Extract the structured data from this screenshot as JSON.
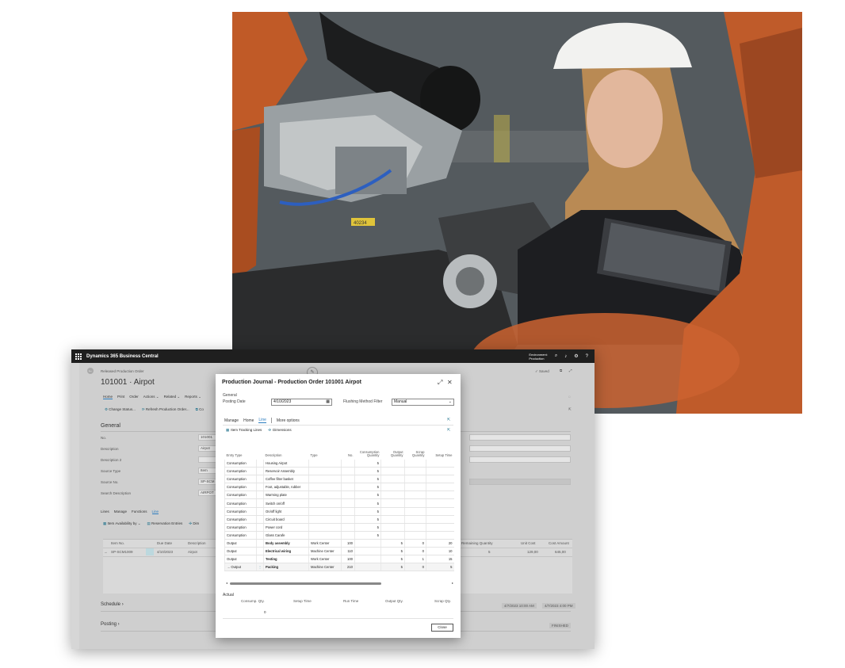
{
  "photo": {
    "tag_label": "40234"
  },
  "app": {
    "name": "Dynamics 365 Business Central",
    "environment": [
      "Environment:",
      "Production"
    ],
    "icons": [
      "waffle-icon",
      "search-icon",
      "bell-icon",
      "gear-icon",
      "help-icon"
    ]
  },
  "page": {
    "breadcrumb": "Released Production Order",
    "title": "101001 · Airpot",
    "status": "✓ Saved",
    "menu": [
      "Home",
      "Print",
      "Order",
      "Actions ⌄",
      "Related ⌄",
      "Reports ⌄"
    ],
    "actions": [
      "Change Status...",
      "Refresh Production Order...",
      "Co"
    ],
    "general_header": "General",
    "fields": [
      {
        "label": "No.",
        "value": "101001"
      },
      {
        "label": "Description",
        "value": "Airpot"
      },
      {
        "label": "Description 2",
        "value": ""
      },
      {
        "label": "Source Type",
        "value": "Item"
      },
      {
        "label": "Source No.",
        "value": "SP-SCM"
      },
      {
        "label": "Search Description",
        "value": "AIRPOT"
      }
    ],
    "lines": {
      "tabs": [
        "Lines",
        "Manage",
        "Functions",
        "Line"
      ],
      "actions": [
        "Item Availability by ⌄",
        "Reservation Entries",
        "Dim"
      ],
      "columns": [
        "Item No.",
        "Due Date",
        "Description",
        "Remaining Quantity",
        "Unit Cost",
        "Cost Amount"
      ],
      "row": {
        "item": "SP-SCM1009",
        "due": "4/10/2023",
        "desc": "Airpot",
        "remaining": "5",
        "unit_cost": "129,00",
        "cost_amount": "645,00"
      }
    },
    "schedule": {
      "label": "Schedule",
      "values": [
        "4/7/2023 10:00 AM",
        "4/7/2023 4:00 PM"
      ]
    },
    "posting": {
      "label": "Posting",
      "value": "FINISHED"
    }
  },
  "dialog": {
    "title": "Production Journal - Production Order 101001 Airpot",
    "general_label": "General",
    "posting_date_label": "Posting Date",
    "posting_date": "4/10/2023",
    "flushing_label": "Flushing Method Filter",
    "flushing_value": "Manual",
    "tabs": [
      "Manage",
      "Home",
      "Line",
      "More options"
    ],
    "actions": [
      "Item Tracking Lines",
      "Dimensions"
    ],
    "columns": [
      "Entry Type",
      "Description",
      "Type",
      "No.",
      "Consumption Quantity",
      "Output Quantity",
      "Scrap Quantity",
      "Setup Time"
    ],
    "rows": [
      {
        "entry": "Consumption",
        "desc": "Housing Airpot",
        "type": "",
        "no": "",
        "cons": "5",
        "out": "",
        "scrap": "",
        "setup": "",
        "bold": false
      },
      {
        "entry": "Consumption",
        "desc": "Reservoir Assembly",
        "type": "",
        "no": "",
        "cons": "5",
        "out": "",
        "scrap": "",
        "setup": "",
        "bold": false
      },
      {
        "entry": "Consumption",
        "desc": "Coffee filter basket",
        "type": "",
        "no": "",
        "cons": "5",
        "out": "",
        "scrap": "",
        "setup": "",
        "bold": false
      },
      {
        "entry": "Consumption",
        "desc": "Foot, adjustable, rubber",
        "type": "",
        "no": "",
        "cons": "5",
        "out": "",
        "scrap": "",
        "setup": "",
        "bold": false
      },
      {
        "entry": "Consumption",
        "desc": "Warming plate",
        "type": "",
        "no": "",
        "cons": "5",
        "out": "",
        "scrap": "",
        "setup": "",
        "bold": false
      },
      {
        "entry": "Consumption",
        "desc": "Switch on/off",
        "type": "",
        "no": "",
        "cons": "5",
        "out": "",
        "scrap": "",
        "setup": "",
        "bold": false
      },
      {
        "entry": "Consumption",
        "desc": "On/off light",
        "type": "",
        "no": "",
        "cons": "5",
        "out": "",
        "scrap": "",
        "setup": "",
        "bold": false
      },
      {
        "entry": "Consumption",
        "desc": "Circuit board",
        "type": "",
        "no": "",
        "cons": "5",
        "out": "",
        "scrap": "",
        "setup": "",
        "bold": false
      },
      {
        "entry": "Consumption",
        "desc": "Power cord",
        "type": "",
        "no": "",
        "cons": "5",
        "out": "",
        "scrap": "",
        "setup": "",
        "bold": false
      },
      {
        "entry": "Consumption",
        "desc": "Glass Carafe",
        "type": "",
        "no": "",
        "cons": "5",
        "out": "",
        "scrap": "",
        "setup": "",
        "bold": false
      },
      {
        "entry": "Output",
        "desc": "Body assembly",
        "type": "Work Center",
        "no": "100",
        "cons": "",
        "out": "5",
        "scrap": "0",
        "setup": "20",
        "bold": true
      },
      {
        "entry": "Output",
        "desc": "Electrical wiring",
        "type": "Machine Center",
        "no": "110",
        "cons": "",
        "out": "5",
        "scrap": "0",
        "setup": "10",
        "bold": true
      },
      {
        "entry": "Output",
        "desc": "Testing",
        "type": "Work Center",
        "no": "100",
        "cons": "",
        "out": "5",
        "scrap": "1",
        "setup": "15",
        "bold": true
      },
      {
        "entry": "Output",
        "desc": "Packing",
        "type": "Machine Center",
        "no": "210",
        "cons": "",
        "out": "5",
        "scrap": "0",
        "setup": "5",
        "bold": true
      }
    ],
    "actual_label": "Actual",
    "actual_columns": [
      "Consump. Qty.",
      "Setup Time",
      "Run Time",
      "Output Qty.",
      "Scrap Qty."
    ],
    "actual_value": "0",
    "close_label": "Close"
  }
}
